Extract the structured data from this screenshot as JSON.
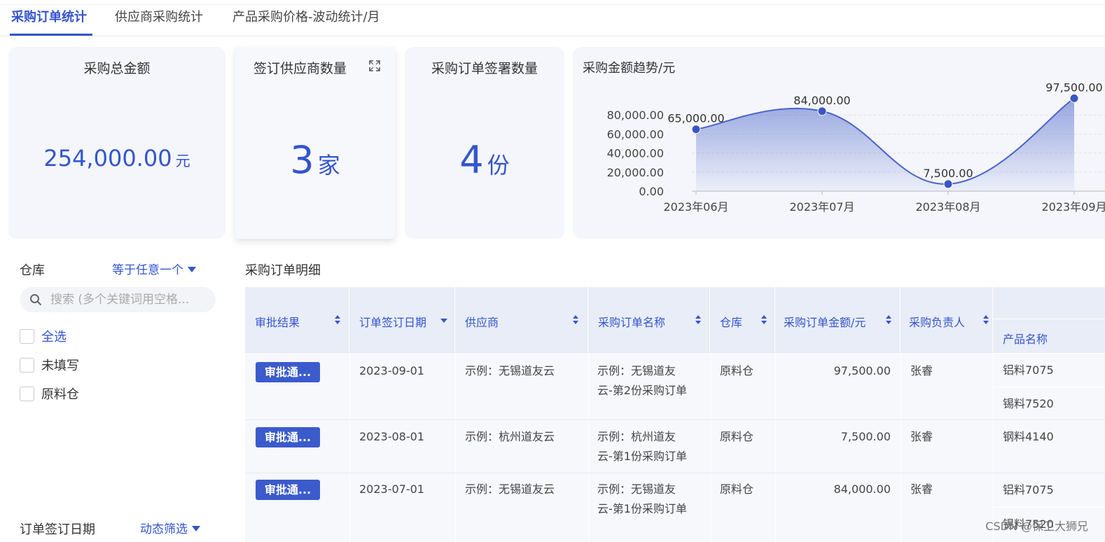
{
  "tabs": [
    {
      "label": "采购订单统计",
      "active": true
    },
    {
      "label": "供应商采购统计",
      "active": false
    },
    {
      "label": "产品采购价格-波动统计/月",
      "active": false
    }
  ],
  "kpis": {
    "total_amount": {
      "title": "采购总金额",
      "value": "254,000.00",
      "unit": "元"
    },
    "supplier_count": {
      "title": "签订供应商数量",
      "value": "3",
      "unit": "家"
    },
    "order_count": {
      "title": "采购订单签署数量",
      "value": "4",
      "unit": "份"
    }
  },
  "chart_data": {
    "type": "area",
    "title": "采购金额趋势/元",
    "categories": [
      "2023年06月",
      "2023年07月",
      "2023年08月",
      "2023年09月"
    ],
    "values": [
      65000,
      84000,
      7500,
      97500
    ],
    "data_labels": [
      "65,000.00",
      "84,000.00",
      "7,500.00",
      "97,500.00"
    ],
    "y_ticks": [
      "0.00",
      "20,000.00",
      "40,000.00",
      "60,000.00",
      "80,000.00"
    ],
    "ylim": [
      0,
      100000
    ],
    "smooth": true,
    "grid": true,
    "color": "#4a63c8"
  },
  "filters": {
    "warehouse": {
      "label": "仓库",
      "mode": "等于任意一个",
      "search_placeholder": "搜索 (多个关键词用空格...",
      "options": [
        {
          "label": "全选",
          "highlight": true
        },
        {
          "label": "未填写",
          "highlight": false
        },
        {
          "label": "原料仓",
          "highlight": false
        }
      ]
    },
    "sign_date": {
      "label": "订单签订日期",
      "mode": "动态筛选"
    }
  },
  "table": {
    "title": "采购订单明细",
    "columns": [
      "审批结果",
      "订单签订日期",
      "供应商",
      "采购订单名称",
      "仓库",
      "采购订单金额/元",
      "采购负责人",
      "产品名称"
    ],
    "rows": [
      {
        "status": "审批通...",
        "date": "2023-09-01",
        "supplier": "示例：无锡道友云",
        "name_line1": "示例：无锡道友",
        "name_line2": "云-第2份采购订单",
        "warehouse": "原料仓",
        "amount": "97,500.00",
        "owner": "张睿",
        "products": [
          "铝料7075",
          "锡料7520"
        ]
      },
      {
        "status": "审批通...",
        "date": "2023-08-01",
        "supplier": "示例：杭州道友云",
        "name_line1": "示例：杭州道友",
        "name_line2": "云-第1份采购订单",
        "warehouse": "原料仓",
        "amount": "7,500.00",
        "owner": "张睿",
        "products": [
          "钢料4140"
        ]
      },
      {
        "status": "审批通...",
        "date": "2023-07-01",
        "supplier": "示例：无锡道友云",
        "name_line1": "示例：无锡道友",
        "name_line2": "云-第1份采购订单",
        "warehouse": "原料仓",
        "amount": "84,000.00",
        "owner": "张睿",
        "products": [
          "铝料7075",
          "锡料7520"
        ]
      }
    ]
  },
  "watermark": "CSDN @保卫大狮兄",
  "colors": {
    "accent": "#3355cc",
    "badge": "#3b5bcc",
    "card_bg": "#f4f6fb",
    "header_bg": "#e9edf8"
  }
}
